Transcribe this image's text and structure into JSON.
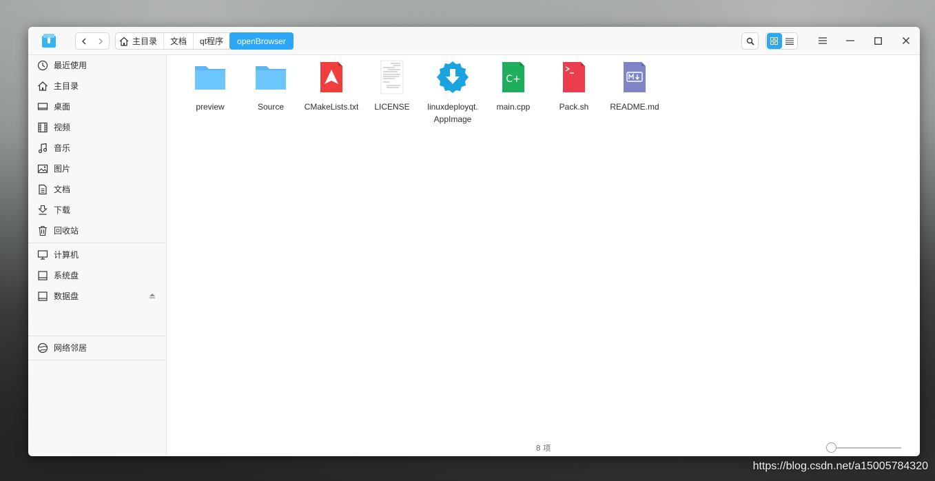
{
  "window": {
    "breadcrumbs": [
      "主目录",
      "文档",
      "qt程序",
      "openBrowser"
    ]
  },
  "sidebar": {
    "items": [
      {
        "label": "最近使用",
        "icon": "clock-icon"
      },
      {
        "label": "主目录",
        "icon": "home-icon"
      },
      {
        "label": "桌面",
        "icon": "desktop-icon"
      },
      {
        "label": "视频",
        "icon": "video-icon"
      },
      {
        "label": "音乐",
        "icon": "music-icon"
      },
      {
        "label": "图片",
        "icon": "picture-icon"
      },
      {
        "label": "文档",
        "icon": "document-icon"
      },
      {
        "label": "下载",
        "icon": "download-icon"
      },
      {
        "label": "回收站",
        "icon": "trash-icon"
      }
    ],
    "devices": [
      {
        "label": "计算机",
        "icon": "computer-icon"
      },
      {
        "label": "系统盘",
        "icon": "disk-icon"
      },
      {
        "label": "数据盘",
        "icon": "disk-icon"
      }
    ],
    "network": {
      "label": "网络邻居",
      "icon": "network-icon"
    }
  },
  "files": [
    {
      "name": "preview",
      "type": "folder"
    },
    {
      "name": "Source",
      "type": "folder"
    },
    {
      "name": "CMakeLists.txt",
      "type": "cmake"
    },
    {
      "name": "LICENSE",
      "type": "text"
    },
    {
      "name": "linuxdeployqt.AppImage",
      "type": "appimage"
    },
    {
      "name": "main.cpp",
      "type": "cpp"
    },
    {
      "name": "Pack.sh",
      "type": "shell"
    },
    {
      "name": "README.md",
      "type": "markdown"
    }
  ],
  "status": {
    "item_count": "8 项"
  },
  "colors": {
    "accent": "#2ca7f8",
    "folder": "#63c1f9"
  },
  "watermark": "https://blog.csdn.net/a15005784320"
}
